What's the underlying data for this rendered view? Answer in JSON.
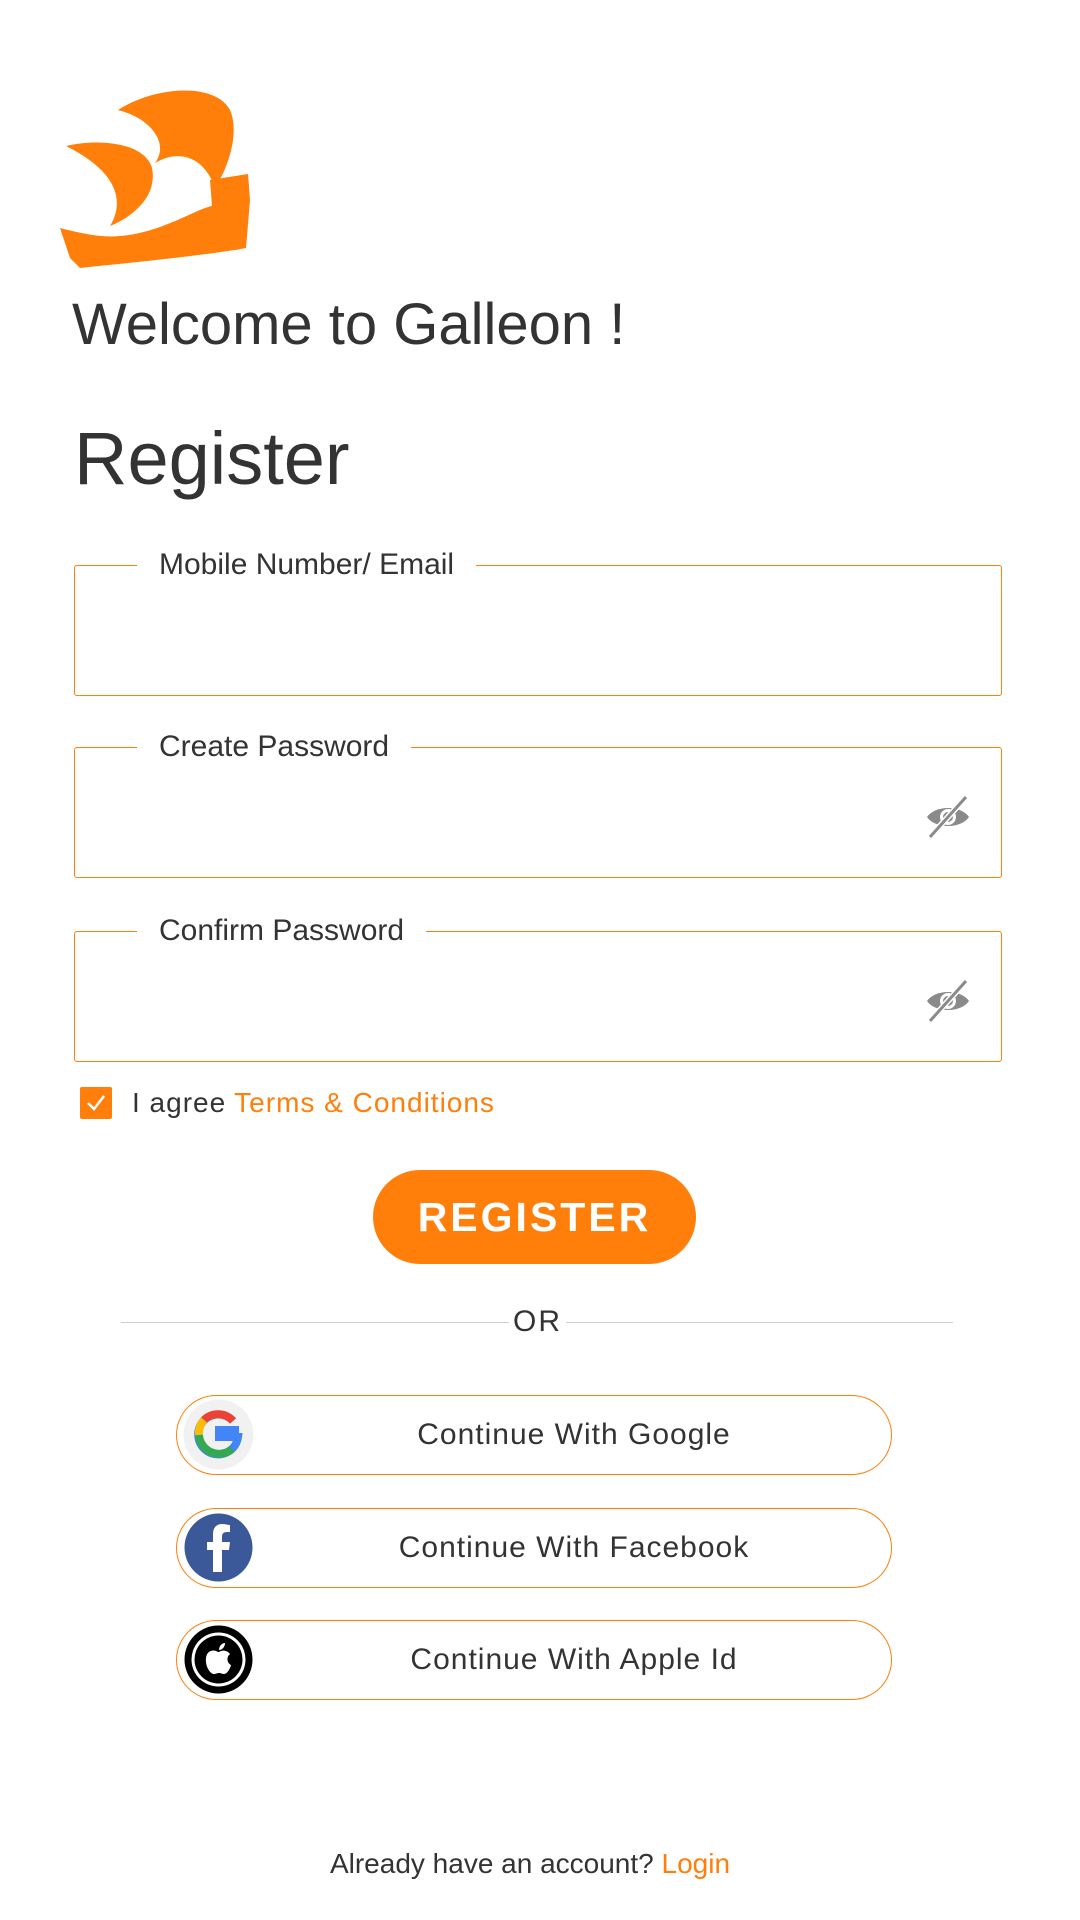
{
  "brand": {
    "logo_icon": "galleon-ship-logo",
    "accent_color": "#ff7f0a"
  },
  "welcome": "Welcome to Galleon !",
  "title": "Register",
  "fields": {
    "mobile": {
      "label": "Mobile Number/ Email",
      "value": ""
    },
    "password": {
      "label": "Create Password",
      "value": "",
      "icon": "eye-slash-icon"
    },
    "confirm": {
      "label": "Confirm Password",
      "value": "",
      "icon": "eye-slash-icon"
    }
  },
  "agree": {
    "checked": true,
    "text": "I agree",
    "link": "Terms & Conditions"
  },
  "register_button": "REGISTER",
  "divider": "OR",
  "social": {
    "google": {
      "label": "Continue With Google",
      "icon": "google-icon"
    },
    "facebook": {
      "label": "Continue With Facebook",
      "icon": "facebook-icon"
    },
    "apple": {
      "label": "Continue With Apple Id",
      "icon": "apple-icon"
    }
  },
  "footer": {
    "text": "Already have an account?",
    "link": "Login"
  }
}
